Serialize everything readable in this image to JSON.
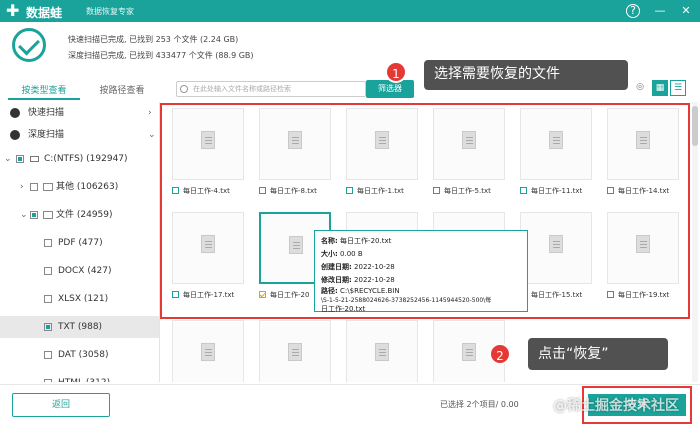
{
  "titlebar": {
    "logo": "✚",
    "brand": "数据蛙",
    "subtitle": "数据恢复专家",
    "buttons": [
      "?",
      "—",
      "✕"
    ]
  },
  "status": {
    "line1": "快速扫描已完成, 已找到 253 个文件 (2.24 GB)",
    "line2": "深度扫描已完成, 已找到 433477 个文件 (88.9 GB)"
  },
  "tabs": [
    {
      "label": "按类型查看",
      "active": true
    },
    {
      "label": "按路径查看",
      "active": false
    }
  ],
  "search": {
    "placeholder": "在此处输入文件名称或路径检索"
  },
  "toolbar": {
    "filter_label": "筛选器",
    "view_grid": "▦",
    "view_list": "☰",
    "view_eye": "◎"
  },
  "sidebar": {
    "items": [
      {
        "label": "快速扫描",
        "arrow": "›"
      },
      {
        "label": "深度扫描",
        "arrow": "⌄"
      },
      {
        "label": "C:(NTFS) (192947)",
        "arrow": "⌄"
      },
      {
        "label": "其他 (106263)",
        "arrow": "›"
      },
      {
        "label": "文件 (24959)",
        "arrow": "⌄"
      },
      {
        "label": "PDF (477)"
      },
      {
        "label": "DOCX (427)"
      },
      {
        "label": "XLSX (121)"
      },
      {
        "label": "TXT (988)"
      },
      {
        "label": "DAT (3058)"
      },
      {
        "label": "HTML (312)"
      }
    ]
  },
  "files": [
    {
      "name": "每日工作-4.txt",
      "checked": false
    },
    {
      "name": "每日工作-8.txt",
      "checked": false
    },
    {
      "name": "每日工作-1.txt",
      "checked": false
    },
    {
      "name": "每日工作-5.txt",
      "checked": false
    },
    {
      "name": "每日工作-11.txt",
      "checked": false
    },
    {
      "name": "每日工作-14.txt",
      "checked": false
    },
    {
      "name": "每日工作-17.txt",
      "checked": false
    },
    {
      "name": "每日工作-20",
      "checked": true
    },
    {
      "name": "",
      "checked": false
    },
    {
      "name": "",
      "checked": false
    },
    {
      "name": "每日工作-15.txt",
      "checked": false
    },
    {
      "name": "每日工作-19.txt",
      "checked": false
    }
  ],
  "tooltip": {
    "name_label": "名称:",
    "name": "每日工作-20.txt",
    "size_label": "大小:",
    "size": "0.00 B",
    "created_label": "创建日期:",
    "created": "2022-10-28",
    "modified_label": "修改日期:",
    "modified": "2022-10-28",
    "path_label": "路径:",
    "path1": "C:\\$RECYCLE.BIN",
    "path2": "\\S-1-5-21-2588024626-3738252456-1145944520-500\\每",
    "path3": "日工作-20.txt"
  },
  "callouts": {
    "step1_num": "1",
    "step1_text": "选择需要恢复的文件",
    "step2_num": "2",
    "step2_text": "点击“恢复”"
  },
  "bottom": {
    "back_label": "返回",
    "selected_text": "已选择 2个项目/ 0.00",
    "recover_label": "恢复",
    "watermark": "@稀土掘金技术社区"
  }
}
